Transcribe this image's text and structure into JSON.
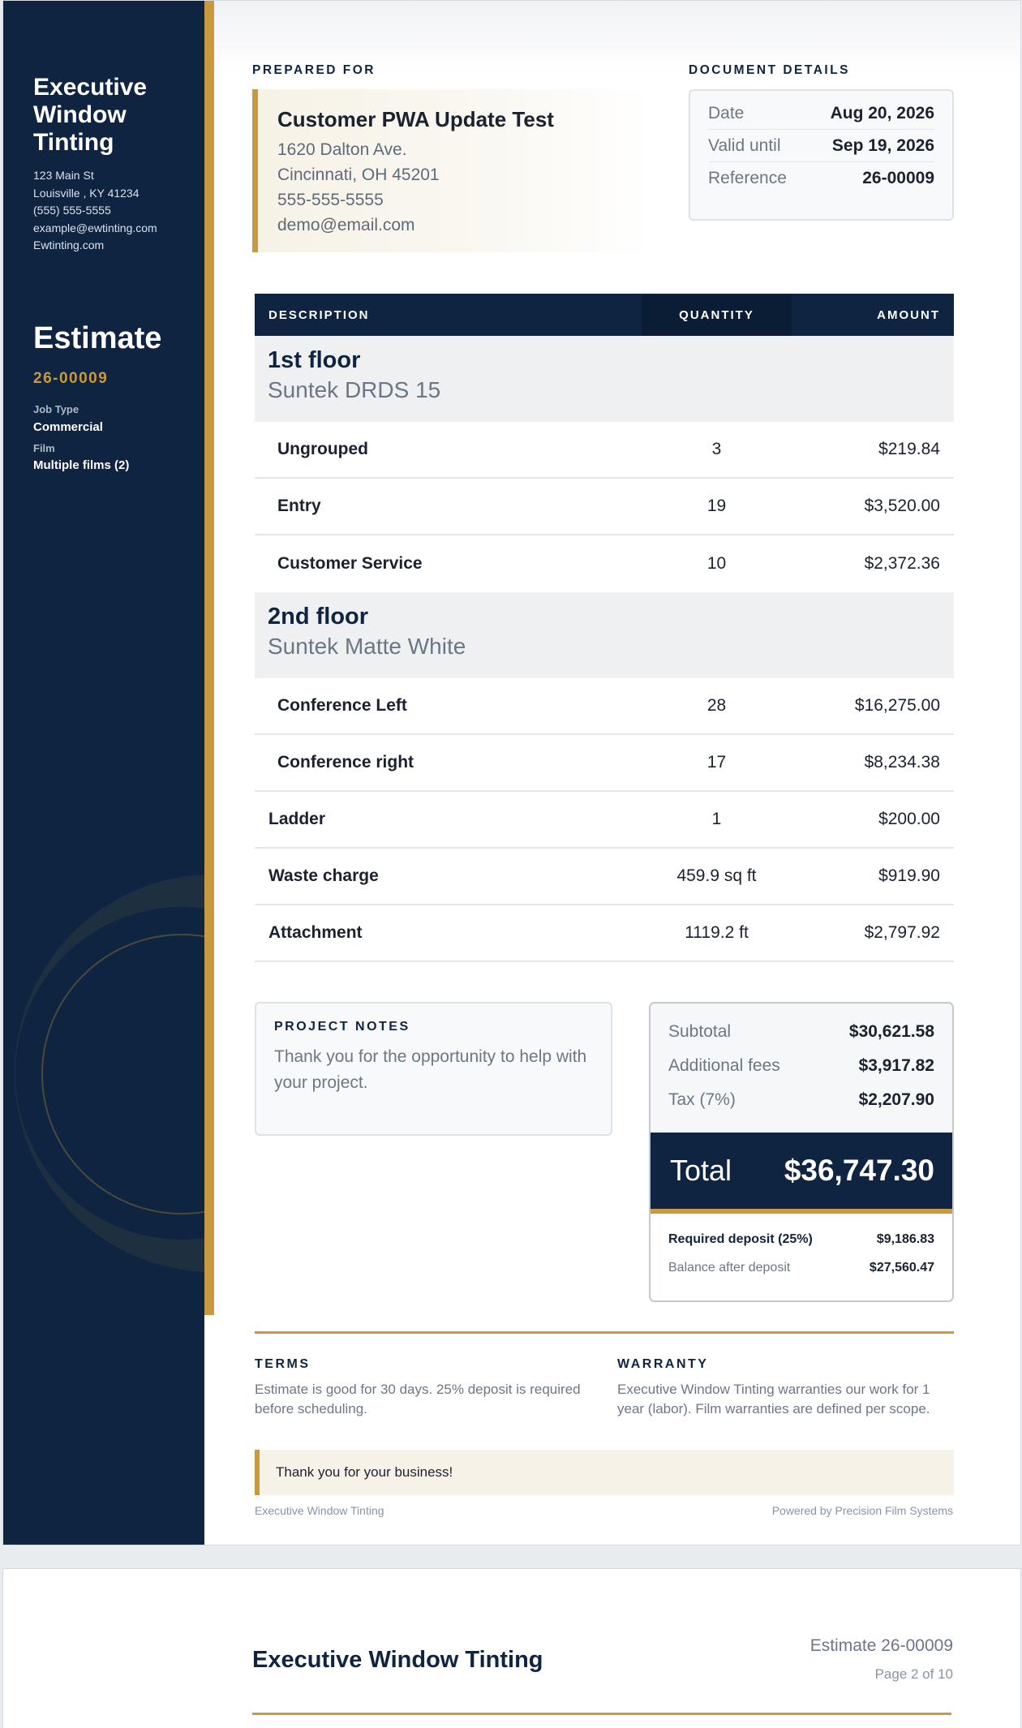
{
  "company": {
    "name": "Executive Window Tinting",
    "address": "123 Main St",
    "city": "Louisville , KY 41234",
    "phone": "(555) 555-5555",
    "email": "example@ewtinting.com",
    "website": "Ewtinting.com"
  },
  "document": {
    "type": "Estimate",
    "number": "26-00009",
    "job_type_label": "Job Type",
    "job_type": "Commercial",
    "film_label": "Film",
    "film": "Multiple films (2)"
  },
  "prepared_for": {
    "label": "PREPARED FOR",
    "name": "Customer PWA Update Test",
    "address": "1620 Dalton Ave.",
    "city": "Cincinnati, OH 45201",
    "phone": "555-555-5555",
    "email": "demo@email.com"
  },
  "details": {
    "label": "DOCUMENT DETAILS",
    "rows": [
      {
        "label": "Date",
        "value": "Aug 20, 2026"
      },
      {
        "label": "Valid until",
        "value": "Sep 19, 2026"
      },
      {
        "label": "Reference",
        "value": "26-00009"
      }
    ]
  },
  "table": {
    "headers": {
      "description": "DESCRIPTION",
      "quantity": "QUANTITY",
      "amount": "AMOUNT"
    },
    "groups": [
      {
        "title": "1st floor",
        "film": "Suntek DRDS 15",
        "items": [
          {
            "desc": "Ungrouped",
            "qty": "3",
            "amount": "$219.84"
          },
          {
            "desc": "Entry",
            "qty": "19",
            "amount": "$3,520.00"
          },
          {
            "desc": "Customer Service",
            "qty": "10",
            "amount": "$2,372.36"
          }
        ]
      },
      {
        "title": "2nd floor",
        "film": "Suntek Matte White",
        "items": [
          {
            "desc": "Conference Left",
            "qty": "28",
            "amount": "$16,275.00"
          },
          {
            "desc": "Conference right",
            "qty": "17",
            "amount": "$8,234.38"
          }
        ]
      }
    ],
    "extras": [
      {
        "desc": "Ladder",
        "qty": "1",
        "amount": "$200.00"
      },
      {
        "desc": "Waste charge",
        "qty": "459.9 sq ft",
        "amount": "$919.90"
      },
      {
        "desc": "Attachment",
        "qty": "1119.2 ft",
        "amount": "$2,797.92"
      }
    ]
  },
  "notes": {
    "label": "PROJECT NOTES",
    "text": "Thank you for the opportunity to help with your project."
  },
  "totals": {
    "subtotal_label": "Subtotal",
    "subtotal": "$30,621.58",
    "fees_label": "Additional fees",
    "fees": "$3,917.82",
    "tax_label": "Tax (7%)",
    "tax": "$2,207.90",
    "total_label": "Total",
    "total": "$36,747.30",
    "deposit_label": "Required deposit (25%)",
    "deposit": "$9,186.83",
    "balance_label": "Balance after deposit",
    "balance": "$27,560.47"
  },
  "terms": {
    "label": "TERMS",
    "text": "Estimate is good for 30 days. 25% deposit is required before scheduling."
  },
  "warranty": {
    "label": "WARRANTY",
    "text": "Executive Window Tinting warranties our work for 1 year (labor). Film warranties are defined per scope."
  },
  "thanks": "Thank you for your business!",
  "footer": {
    "left": "Executive Window Tinting",
    "right": "Powered by Precision Film Systems"
  },
  "page2": {
    "title": "Executive Window Tinting",
    "estimate": "Estimate 26-00009",
    "page": "Page 2 of 10"
  },
  "colors": {
    "navy": "#0f2440",
    "gold": "#c9993f"
  }
}
